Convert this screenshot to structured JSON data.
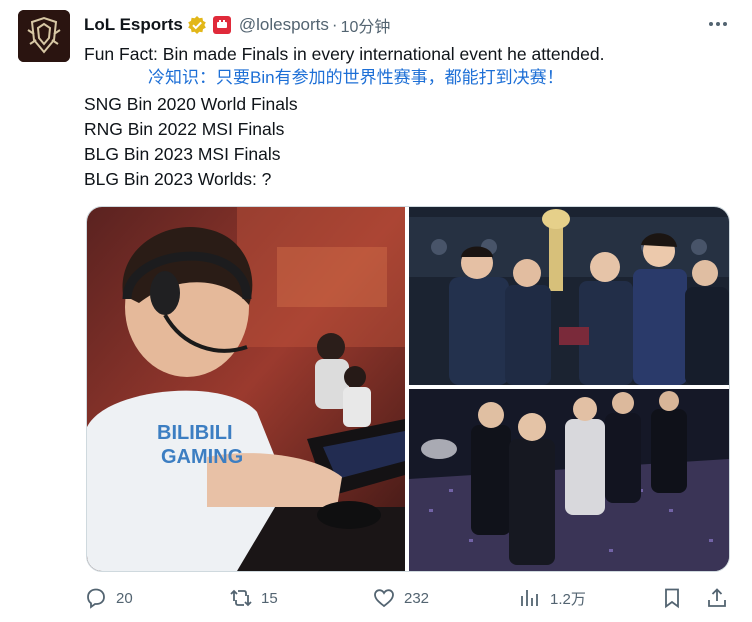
{
  "account": {
    "display_name": "LoL Esports",
    "handle": "@lolesports",
    "separator": "·",
    "time": "10分钟"
  },
  "tweet": {
    "lines": [
      "Fun Fact: Bin made Finals in every international event he attended.",
      "SNG Bin 2020 World Finals",
      "RNG Bin 2022 MSI Finals",
      "BLG Bin 2023 MSI Finals",
      "BLG Bin 2023 Worlds: ?"
    ],
    "translation": "冷知识：只要Bin有参加的世界性赛事，都能打到决赛！"
  },
  "media": {
    "photo_count": 3,
    "main_jersey_text": [
      "BILIBILI",
      "GAMING"
    ]
  },
  "actions": {
    "reply_count": "20",
    "retweet_count": "15",
    "like_count": "232",
    "view_count": "1.2万"
  },
  "colors": {
    "text": "#0f1419",
    "muted": "#536471",
    "translation": "#1d6fd6",
    "verified_gold": "#e2b719",
    "affiliate_red": "#e02a3a"
  },
  "icons": [
    "more-icon",
    "verified-badge-icon",
    "affiliate-badge-icon",
    "reply-icon",
    "retweet-icon",
    "like-icon",
    "views-icon",
    "bookmark-icon",
    "share-icon"
  ]
}
